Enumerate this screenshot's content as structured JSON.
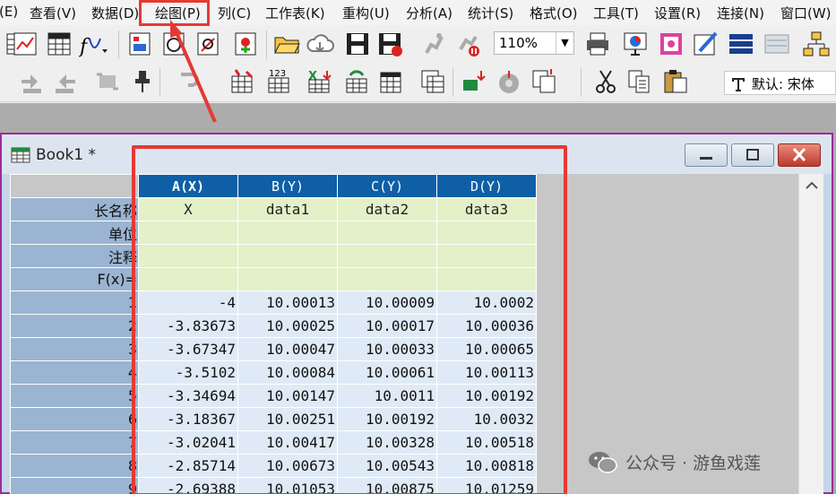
{
  "menu": [
    "(E)",
    "查看(V)",
    "数据(D)",
    "绘图(P)",
    "列(C)",
    "工作表(K)",
    "重构(U)",
    "分析(A)",
    "统计(S)",
    "格式(O)",
    "工具(T)",
    "设置(R)",
    "连接(N)",
    "窗口(W)"
  ],
  "toolbar": {
    "zoom": "110%",
    "font_label": "默认: 宋体"
  },
  "book": {
    "title": "Book1 *"
  },
  "sheet": {
    "columns": [
      "A(X)",
      "B(Y)",
      "C(Y)",
      "D(Y)"
    ],
    "meta_row_labels": [
      "长名称",
      "单位",
      "注释",
      "F(x)="
    ],
    "long_names": [
      "X",
      "data1",
      "data2",
      "data3"
    ],
    "row_numbers": [
      "1",
      "2",
      "3",
      "4",
      "5",
      "6",
      "7",
      "8",
      "9"
    ],
    "rows": [
      [
        "-4",
        "10.00013",
        "10.00009",
        "10.0002"
      ],
      [
        "-3.83673",
        "10.00025",
        "10.00017",
        "10.00036"
      ],
      [
        "-3.67347",
        "10.00047",
        "10.00033",
        "10.00065"
      ],
      [
        "-3.5102",
        "10.00084",
        "10.00061",
        "10.00113"
      ],
      [
        "-3.34694",
        "10.00147",
        "10.0011",
        "10.00192"
      ],
      [
        "-3.18367",
        "10.00251",
        "10.00192",
        "10.0032"
      ],
      [
        "-3.02041",
        "10.00417",
        "10.00328",
        "10.00518"
      ],
      [
        "-2.85714",
        "10.00673",
        "10.00543",
        "10.00818"
      ],
      [
        "-2.69388",
        "10.01053",
        "10.00875",
        "10.01259"
      ]
    ]
  },
  "watermark": "公众号 · 游鱼戏莲",
  "colors": {
    "highlight": "#e53935",
    "header_blue": "#0e5fa6",
    "meta_green": "#e3f0c8",
    "row_header": "#9ab4d1"
  }
}
